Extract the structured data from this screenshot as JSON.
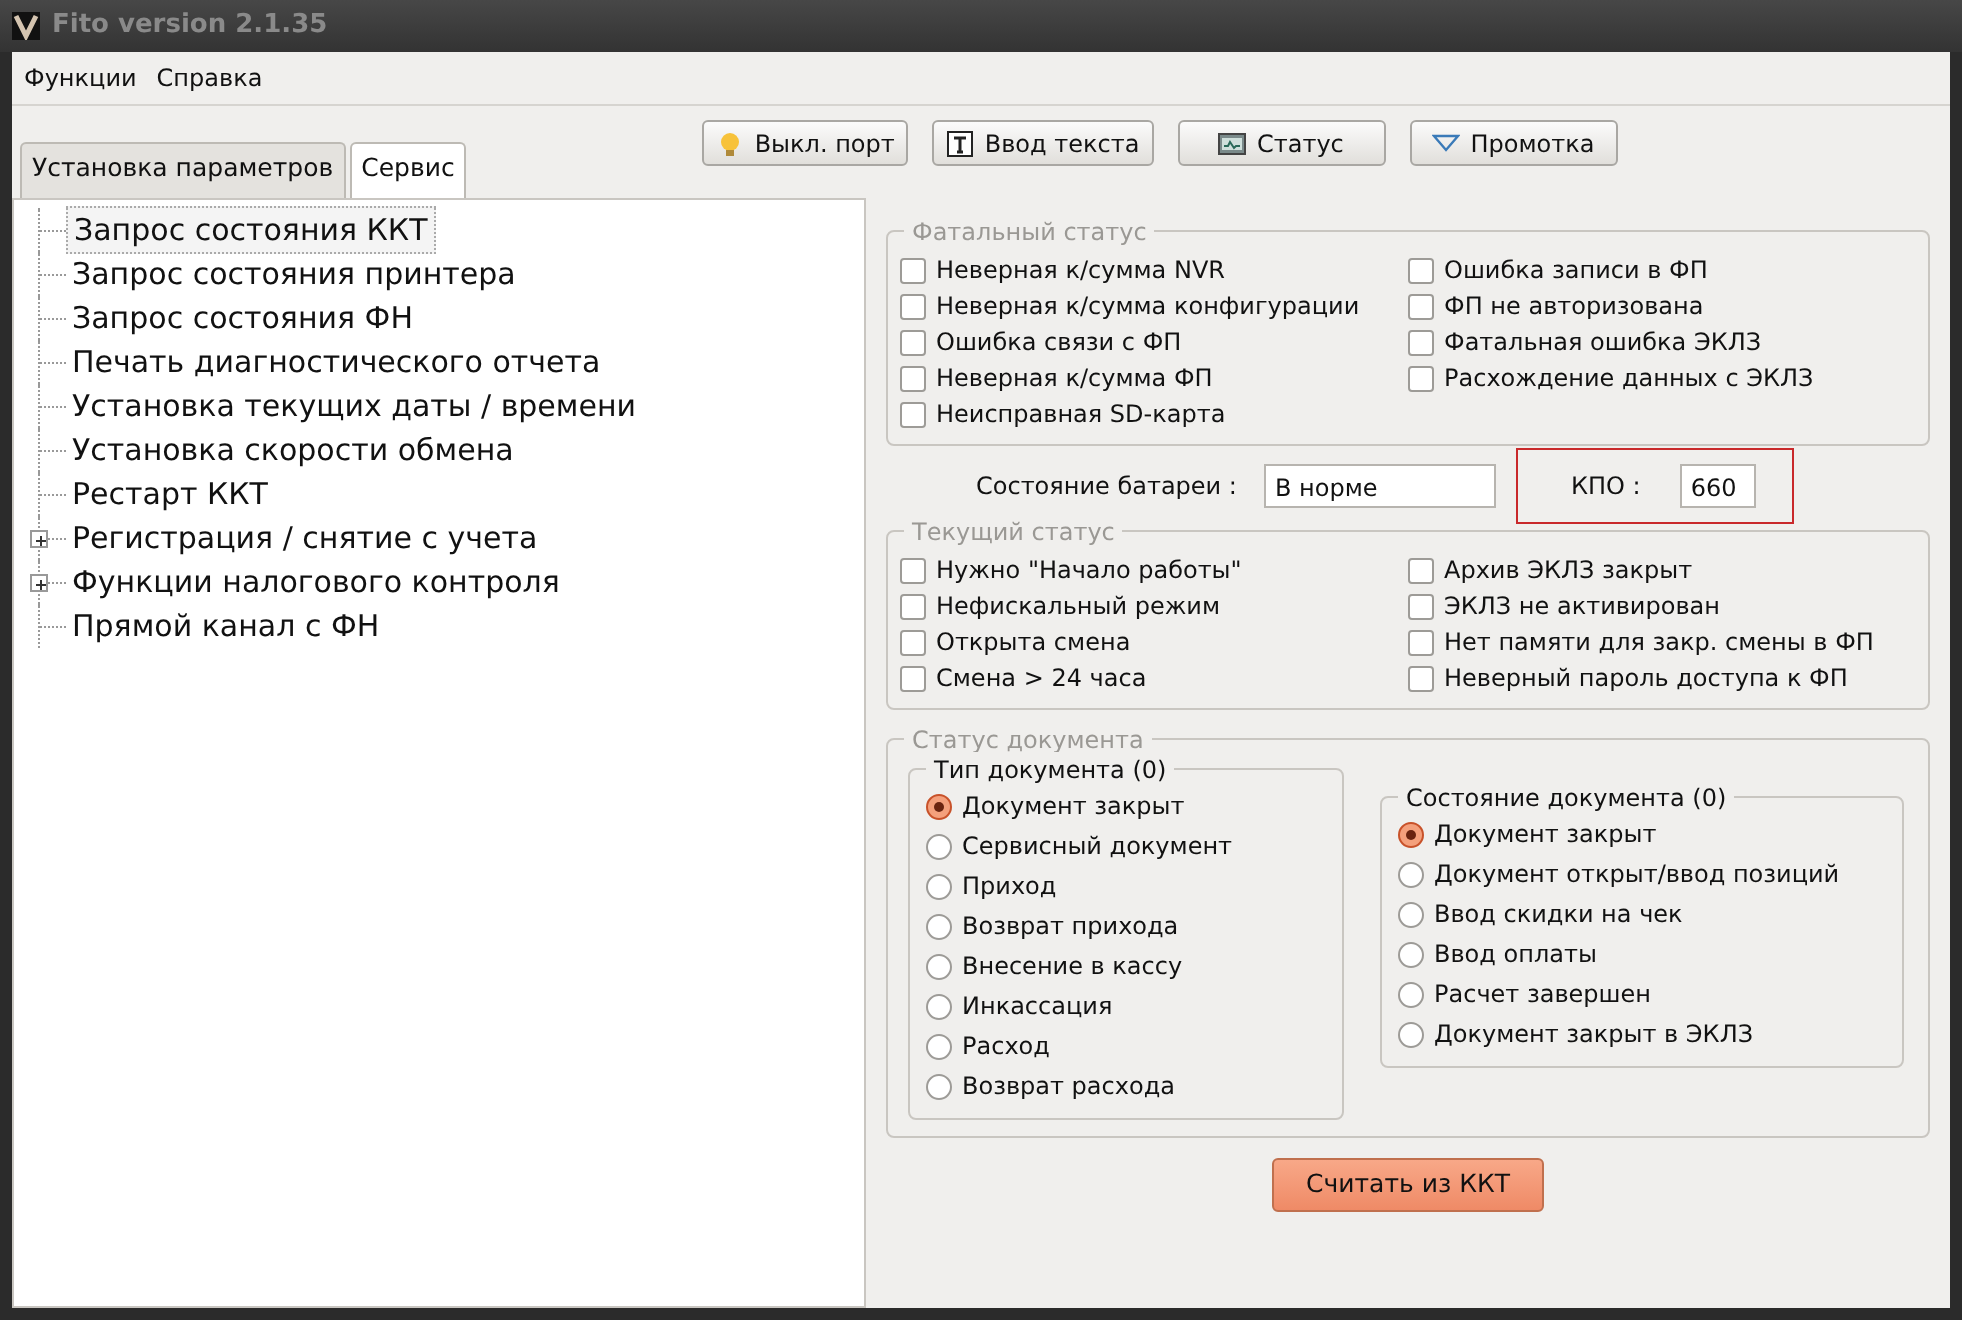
{
  "window": {
    "title": "Fito version 2.1.35"
  },
  "menu": [
    "Функции",
    "Справка"
  ],
  "tabs": [
    {
      "label": "Установка параметров",
      "selected": false
    },
    {
      "label": "Сервис",
      "selected": true
    }
  ],
  "toolbar": [
    {
      "label": "Выкл. порт",
      "kind": "bulb"
    },
    {
      "label": "Ввод текста",
      "kind": "text"
    },
    {
      "label": "Статус",
      "kind": "monitor"
    },
    {
      "label": "Промотка",
      "kind": "triangle"
    }
  ],
  "tree": [
    {
      "label": "Запрос состояния ККТ",
      "selected": true
    },
    {
      "label": "Запрос состояния принтера",
      "selected": false
    },
    {
      "label": "Запрос состояния ФН",
      "selected": false
    },
    {
      "label": "Печать диагностического отчета",
      "selected": false
    },
    {
      "label": "Установка текущих даты / времени",
      "selected": false
    },
    {
      "label": "Установка скорости обмена",
      "selected": false
    },
    {
      "label": "Рестарт ККТ",
      "selected": false
    },
    {
      "label": "Регистрация / снятие с учета",
      "selected": false,
      "expanded": false
    },
    {
      "label": "Функции налогового контроля",
      "selected": false,
      "expanded": false
    },
    {
      "label": "Прямой канал с ФН",
      "selected": false
    }
  ],
  "fatal_status": {
    "title": "Фатальный статус",
    "left": [
      {
        "label": "Неверная к/сумма NVR",
        "checked": false
      },
      {
        "label": "Неверная к/сумма конфигурации",
        "checked": false
      },
      {
        "label": "Ошибка связи с ФП",
        "checked": false
      },
      {
        "label": "Неверная к/сумма ФП",
        "checked": false
      },
      {
        "label": "Неисправная SD-карта",
        "checked": false
      }
    ],
    "right": [
      {
        "label": "Ошибка записи в ФП",
        "checked": false
      },
      {
        "label": "ФП не авторизована",
        "checked": false
      },
      {
        "label": "Фатальная ошибка ЭКЛЗ",
        "checked": false
      },
      {
        "label": "Расхождение данных с ЭКЛЗ",
        "checked": false
      }
    ]
  },
  "battery": {
    "label": "Состояние батареи :",
    "value": "В норме"
  },
  "kpo": {
    "label": "КПО :",
    "value": "660",
    "highlighted": true
  },
  "current_status": {
    "title": "Текущий статус",
    "left": [
      {
        "label": "Нужно \"Начало работы\"",
        "checked": false
      },
      {
        "label": "Нефискальный режим",
        "checked": false
      },
      {
        "label": "Открыта смена",
        "checked": false
      },
      {
        "label": "Смена > 24 часа",
        "checked": false
      }
    ],
    "right": [
      {
        "label": "Архив ЭКЛЗ закрыт",
        "checked": false
      },
      {
        "label": "ЭКЛЗ не активирован",
        "checked": false
      },
      {
        "label": "Нет памяти для закр. смены в ФП",
        "checked": false
      },
      {
        "label": "Неверный пароль доступа к ФП",
        "checked": false
      }
    ]
  },
  "document_status": {
    "title": "Статус документа",
    "type": {
      "title": "Тип документа (0)",
      "options": [
        {
          "label": "Документ закрыт",
          "selected": true
        },
        {
          "label": "Сервисный документ",
          "selected": false
        },
        {
          "label": "Приход",
          "selected": false
        },
        {
          "label": "Возврат прихода",
          "selected": false
        },
        {
          "label": "Внесение в кассу",
          "selected": false
        },
        {
          "label": "Инкассация",
          "selected": false
        },
        {
          "label": "Расход",
          "selected": false
        },
        {
          "label": "Возврат расхода",
          "selected": false
        }
      ]
    },
    "state": {
      "title": "Состояние документа (0)",
      "options": [
        {
          "label": "Документ закрыт",
          "selected": true
        },
        {
          "label": "Документ открыт/ввод позиций",
          "selected": false
        },
        {
          "label": "Ввод скидки на чек",
          "selected": false
        },
        {
          "label": "Ввод оплаты",
          "selected": false
        },
        {
          "label": "Расчет завершен",
          "selected": false
        },
        {
          "label": "Документ закрыт в ЭКЛЗ",
          "selected": false
        }
      ]
    }
  },
  "read_button": "Считать из ККТ"
}
